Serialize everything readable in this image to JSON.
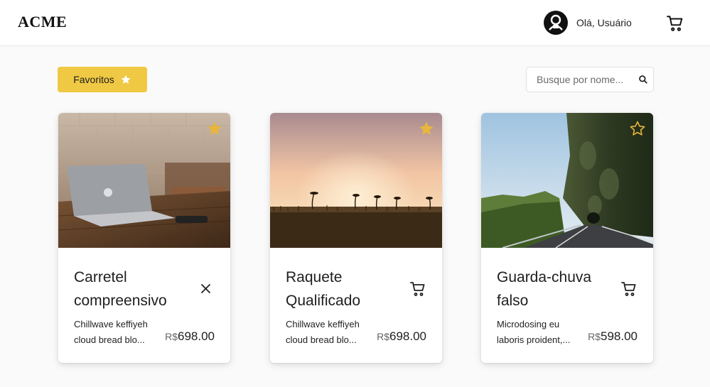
{
  "header": {
    "logo": "ACME",
    "greeting": "Olá, Usuário",
    "avatar_icon": "user-avatar-icon",
    "cart_icon": "cart-icon"
  },
  "toolbar": {
    "favorites_label": "Favoritos",
    "favorites_icon": "star-icon",
    "search_placeholder": "Busque por nome...",
    "search_value": ""
  },
  "colors": {
    "accent": "#f0c944",
    "star": "#e8b63a"
  },
  "products": [
    {
      "title_line1": "Carretel",
      "title_line2": "compreensivo",
      "desc_line1": "Chillwave keffiyeh",
      "desc_line2": "cloud bread blo...",
      "currency": "R$",
      "price": "698.00",
      "favorite": true,
      "action": "close-icon",
      "image": "laptop-on-desk"
    },
    {
      "title_line1": "Raquete",
      "title_line2": "Qualificado",
      "desc_line1": "Chillwave keffiyeh",
      "desc_line2": "cloud bread blo...",
      "currency": "R$",
      "price": "698.00",
      "favorite": true,
      "action": "cart-icon",
      "image": "sunset-palm-trees"
    },
    {
      "title_line1": "Guarda-chuva",
      "title_line2": "falso",
      "desc_line1": "Microdosing eu",
      "desc_line2": "laboris proident,...",
      "currency": "R$",
      "price": "598.00",
      "favorite": false,
      "action": "cart-icon",
      "image": "cliff-road"
    }
  ]
}
